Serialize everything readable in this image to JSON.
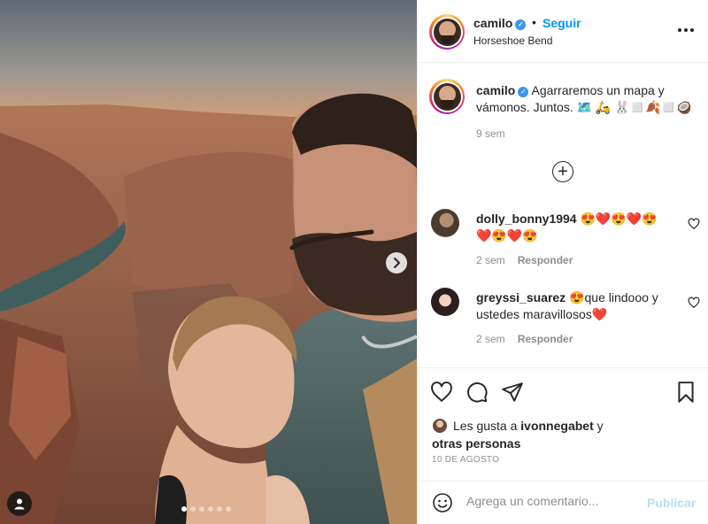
{
  "post": {
    "username": "camilo",
    "separator": "•",
    "follow_label": "Seguir",
    "location": "Horseshoe Bend"
  },
  "caption": {
    "username": "camilo",
    "text": "Agarraremos un mapa y vámonos. Juntos. 🗺️ 🛵 🐰◻️🍂◻️🥥",
    "time": "9 sem"
  },
  "comments": [
    {
      "username": "dolly_bonny1994",
      "text": "😍❤️😍❤️😍❤️😍❤️😍",
      "time": "2 sem",
      "reply_label": "Responder"
    },
    {
      "username": "greyssi_suarez",
      "text": "😍que lindooo y ustedes maravillosos❤️",
      "time": "2 sem",
      "reply_label": "Responder"
    }
  ],
  "likes": {
    "prefix": "Les gusta a",
    "liker": "ivonnegabet",
    "conjunction": "y",
    "others": "otras personas"
  },
  "date": "10 DE AGOSTO",
  "add_comment": {
    "placeholder": "Agrega un comentario...",
    "publish_label": "Publicar"
  },
  "carousel": {
    "slides": 6,
    "active_index": 0
  },
  "colors": {
    "link_blue": "#0095f6",
    "verified_blue": "#3897f0",
    "publish_disabled": "#b2dffc",
    "muted": "#8e8e8e"
  },
  "icons": [
    "verified-icon",
    "more-options-icon",
    "load-more-comments-icon",
    "heart-icon",
    "comment-icon",
    "share-icon",
    "bookmark-icon",
    "emoji-icon",
    "next-arrow-icon",
    "user-tag-icon"
  ]
}
